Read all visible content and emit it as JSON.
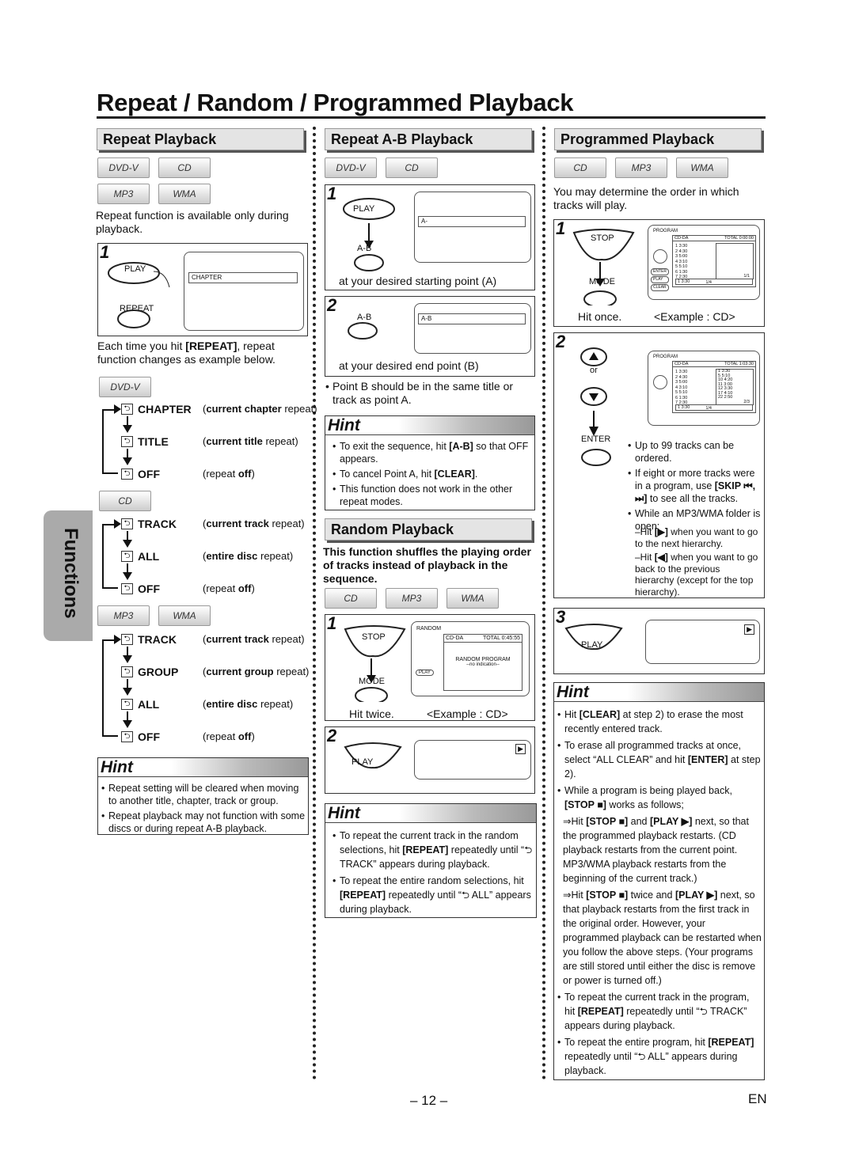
{
  "title": "Repeat / Random / Programmed Playback",
  "side_tab": "Functions",
  "page_number": "– 12 –",
  "language": "EN",
  "discs": {
    "dvdv": "DVD-V",
    "cd": "CD",
    "mp3": "MP3",
    "wma": "WMA"
  },
  "repeat": {
    "heading": "Repeat Playback",
    "intro": "Repeat function is available only during playback.",
    "step1": {
      "num": "1",
      "play": "PLAY",
      "repeat": "REPEAT",
      "screen": "CHAPTER"
    },
    "after": [
      {
        "t": "Each time you hit "
      },
      {
        "t": "[REPEAT]",
        "b": true
      },
      {
        "t": ", repeat function changes as example below."
      }
    ],
    "dvd_items": [
      {
        "label": "CHAPTER",
        "desc": [
          {
            "t": "current chapter",
            "b": true
          },
          {
            "t": " repeat)"
          }
        ],
        "pre": "("
      },
      {
        "label": "TITLE",
        "desc": [
          {
            "t": "current title",
            "b": true
          },
          {
            "t": " repeat)"
          }
        ],
        "pre": "("
      },
      {
        "label": "OFF",
        "desc": [
          {
            "t": "repeat "
          },
          {
            "t": "off",
            "b": true
          },
          {
            "t": ")"
          }
        ],
        "pre": "("
      }
    ],
    "cd_items": [
      {
        "label": "TRACK",
        "desc": [
          {
            "t": "current track",
            "b": true
          },
          {
            "t": " repeat)"
          }
        ],
        "pre": "("
      },
      {
        "label": "ALL",
        "desc": [
          {
            "t": "entire disc",
            "b": true
          },
          {
            "t": " repeat)"
          }
        ],
        "pre": "("
      },
      {
        "label": "OFF",
        "desc": [
          {
            "t": "repeat "
          },
          {
            "t": "off",
            "b": true
          },
          {
            "t": ")"
          }
        ],
        "pre": "("
      }
    ],
    "mp3_items": [
      {
        "label": "TRACK",
        "desc": [
          {
            "t": "current track",
            "b": true
          },
          {
            "t": " repeat)"
          }
        ],
        "pre": "("
      },
      {
        "label": "GROUP",
        "desc": [
          {
            "t": "current group",
            "b": true
          },
          {
            "t": " repeat)"
          }
        ],
        "pre": "("
      },
      {
        "label": "ALL",
        "desc": [
          {
            "t": "entire disc",
            "b": true
          },
          {
            "t": " repeat)"
          }
        ],
        "pre": "("
      },
      {
        "label": "OFF",
        "desc": [
          {
            "t": "repeat "
          },
          {
            "t": "off",
            "b": true
          },
          {
            "t": ")"
          }
        ],
        "pre": "("
      }
    ],
    "hint_title": "Hint",
    "hints": [
      [
        {
          "t": "Repeat setting will be cleared when moving to another title, chapter, track or group."
        }
      ],
      [
        {
          "t": "Repeat playback may not function with some discs or during repeat A-B playback."
        }
      ]
    ]
  },
  "ab": {
    "heading": "Repeat A-B Playback",
    "step1": {
      "num": "1",
      "play": "PLAY",
      "ab": "A-B",
      "screen": "A-",
      "caption": "at your desired starting point (A)"
    },
    "step2": {
      "num": "2",
      "ab": "A-B",
      "screen": "A-B",
      "caption": "at your desired end point (B)"
    },
    "note": [
      {
        "t": "Point B should be in the same title or track as point A."
      }
    ],
    "hint_title": "Hint",
    "hints": [
      [
        {
          "t": "To exit the sequence, hit "
        },
        {
          "t": "[A-B]",
          "b": true
        },
        {
          "t": " so that OFF appears."
        }
      ],
      [
        {
          "t": "To cancel Point A, hit "
        },
        {
          "t": "[CLEAR]",
          "b": true
        },
        {
          "t": "."
        }
      ],
      [
        {
          "t": "This function does not work in the other repeat modes."
        }
      ]
    ]
  },
  "random": {
    "heading": "Random Playback",
    "intro": "This function shuffles the playing order of tracks instead of playback in the sequence.",
    "step1": {
      "num": "1",
      "stop": "STOP",
      "mode": "MODE",
      "caption": "Hit twice.",
      "example": "<Example : CD>",
      "screen": {
        "title": "RANDOM",
        "source": "CD-DA",
        "total": "TOTAL 0:45:55",
        "line1": "RANDOM PROGRAM",
        "line2": "--no indication--",
        "btn": "PLAY"
      }
    },
    "step2": {
      "num": "2",
      "play": "PLAY"
    },
    "hint_title": "Hint",
    "hints": [
      [
        {
          "t": "To repeat the current track in the random selections, hit "
        },
        {
          "t": "[REPEAT]",
          "b": true
        },
        {
          "t": " repeatedly until “⮌ TRACK” appears during playback."
        }
      ],
      [
        {
          "t": "To repeat the entire random selections, hit "
        },
        {
          "t": "[REPEAT]",
          "b": true
        },
        {
          "t": " repeatedly until “⮌ ALL” appears during playback."
        }
      ]
    ]
  },
  "program": {
    "heading": "Programmed Playback",
    "intro": "You may determine the order in which tracks will play.",
    "step1": {
      "num": "1",
      "stop": "STOP",
      "mode": "MODE",
      "caption": "Hit once.",
      "example": "<Example : CD>",
      "screen": {
        "title": "PROGRAM",
        "source": "CD-DA",
        "total": "TOTAL 0:00:00",
        "tracks": [
          "1  3:30",
          "2  4:30",
          "3  5:00",
          "4  3:10",
          "5  5:10",
          "6  1:30",
          "7  2:30"
        ],
        "page": "1/4",
        "page2": "1/1",
        "current": "1  3:30",
        "btns": [
          "ENTER",
          "PLAY",
          "CLEAR"
        ]
      }
    },
    "step2": {
      "num": "2",
      "or": "or",
      "enter": "ENTER",
      "screen": {
        "title": "PROGRAM",
        "source": "CD-DA",
        "total": "TOTAL 1:03:30",
        "tracks": [
          "1  3:30",
          "2  4:30",
          "3  5:00",
          "4  3:10",
          "5  5:10",
          "6  1:30",
          "7  2:30"
        ],
        "prog": [
          "1  3:30",
          "5  5:10",
          "10  4:20",
          "11  3:00",
          "12  3:30",
          "17  4:10",
          "22  2:50"
        ],
        "page": "1/4",
        "page2": "2/3",
        "current": "1  3:30"
      },
      "notes": [
        [
          {
            "t": "Up to 99 tracks can be ordered."
          }
        ],
        [
          {
            "t": "If eight or more tracks were in a program, use "
          },
          {
            "t": "[SKIP ⏮, ⏭]",
            "b": true
          },
          {
            "t": " to see all the tracks."
          }
        ],
        [
          {
            "t": "While an MP3/WMA folder is open:"
          }
        ]
      ],
      "subnotes": [
        [
          {
            "t": "–Hit "
          },
          {
            "t": "[▶]",
            "b": true
          },
          {
            "t": " when you want to go to the next hierarchy."
          }
        ],
        [
          {
            "t": "–Hit "
          },
          {
            "t": "[◀]",
            "b": true
          },
          {
            "t": " when you want to go back to the previous hierarchy (except for the top hierarchy)."
          }
        ]
      ]
    },
    "step3": {
      "num": "3",
      "play": "PLAY"
    },
    "hint_title": "Hint",
    "hints": [
      [
        {
          "t": "Hit "
        },
        {
          "t": "[CLEAR]",
          "b": true
        },
        {
          "t": " at step 2) to erase the most recently entered track."
        }
      ],
      [
        {
          "t": "To erase all programmed tracks at once, select “ALL CLEAR” and hit "
        },
        {
          "t": "[ENTER]",
          "b": true
        },
        {
          "t": " at step 2)."
        }
      ],
      [
        {
          "t": "While a program is being played back, "
        },
        {
          "t": "[STOP ■]",
          "b": true
        },
        {
          "t": " works as follows;"
        }
      ]
    ],
    "hint_sub": [
      [
        {
          "t": "⇒Hit "
        },
        {
          "t": "[STOP ■]",
          "b": true
        },
        {
          "t": " and "
        },
        {
          "t": "[PLAY ▶]",
          "b": true
        },
        {
          "t": " next, so that the programmed playback restarts. (CD playback restarts from the current point. MP3/WMA playback restarts from the beginning of the current track.)"
        }
      ],
      [
        {
          "t": "⇒Hit "
        },
        {
          "t": "[STOP ■]",
          "b": true
        },
        {
          "t": " twice and "
        },
        {
          "t": "[PLAY ▶]",
          "b": true
        },
        {
          "t": " next, so that playback restarts from the first track in the original order. However, your programmed playback can be restarted when you follow the above steps. (Your programs are still stored until either the disc is remove or power is turned off.)"
        }
      ]
    ],
    "hints2": [
      [
        {
          "t": "To repeat the current track in the program, hit "
        },
        {
          "t": "[REPEAT]",
          "b": true
        },
        {
          "t": " repeatedly until “⮌ TRACK” appears during playback."
        }
      ],
      [
        {
          "t": "To repeat the entire program, hit "
        },
        {
          "t": "[REPEAT]",
          "b": true
        },
        {
          "t": " repeatedly until “⮌ ALL” appears during playback."
        }
      ]
    ]
  }
}
